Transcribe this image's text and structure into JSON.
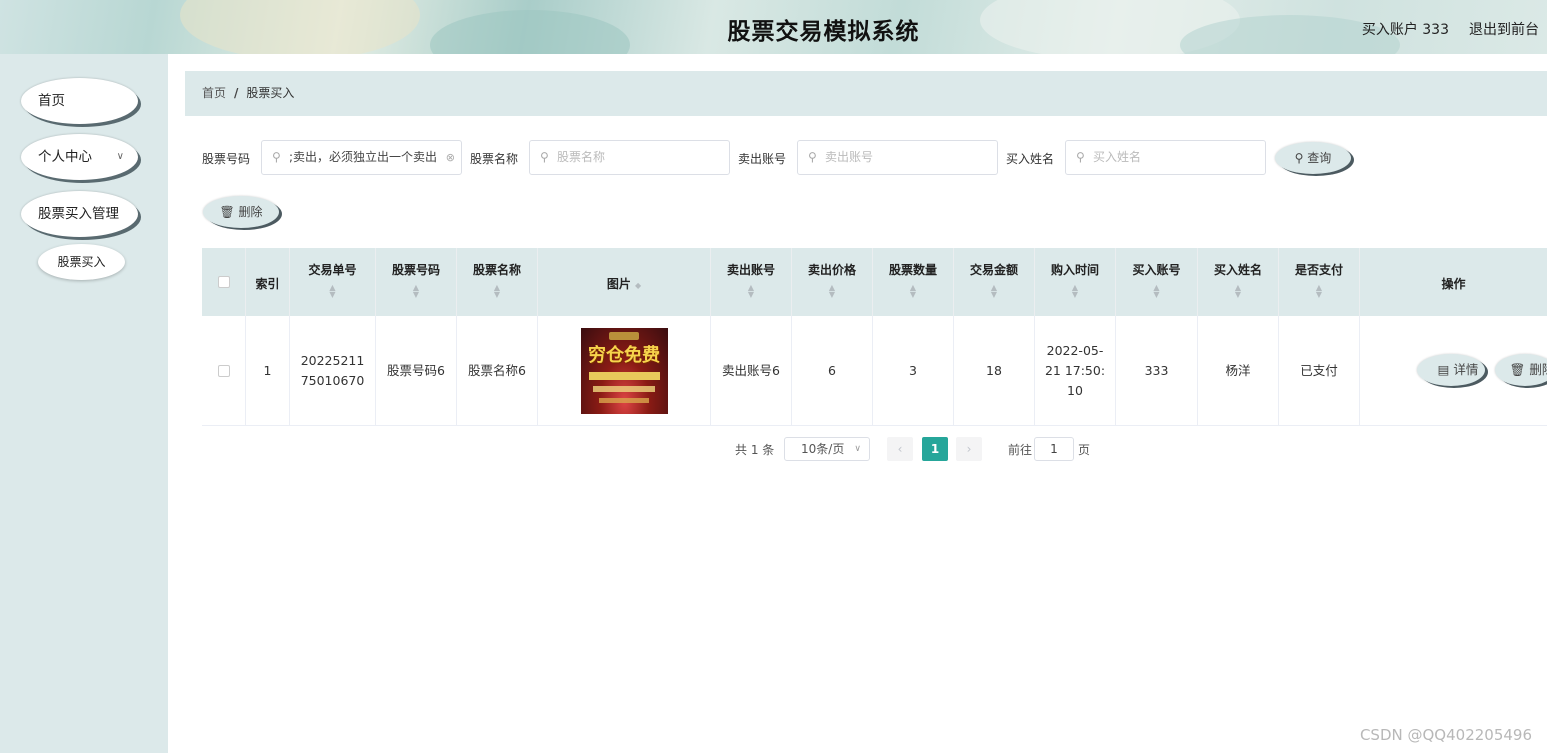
{
  "header": {
    "title": "股票交易模拟系统",
    "account_label": "买入账户 333",
    "logout_label": "退出到前台"
  },
  "sidebar": {
    "items": [
      {
        "label": "首页"
      },
      {
        "label": "个人中心",
        "icon": "chevron-down-icon"
      },
      {
        "label": "股票买入管理"
      }
    ],
    "sub_items": [
      {
        "label": "股票买入"
      }
    ]
  },
  "breadcrumb": {
    "home": "首页",
    "separator": "/",
    "current": "股票买入"
  },
  "search": {
    "fields": [
      {
        "label": "股票号码",
        "value": ";卖出，必须独立出一个卖出",
        "placeholder": "股票号码"
      },
      {
        "label": "股票名称",
        "value": "",
        "placeholder": "股票名称"
      },
      {
        "label": "卖出账号",
        "value": "",
        "placeholder": "卖出账号"
      },
      {
        "label": "买入姓名",
        "value": "",
        "placeholder": "买入姓名"
      }
    ],
    "query_label": "查询",
    "delete_label": "删除"
  },
  "table": {
    "columns": [
      "",
      "索引",
      "交易单号",
      "股票号码",
      "股票名称",
      "图片",
      "卖出账号",
      "卖出价格",
      "股票数量",
      "交易金额",
      "购入时间",
      "买入账号",
      "买入姓名",
      "是否支付",
      "操作"
    ],
    "rows": [
      {
        "index": "1",
        "order_no": "2022521175010670",
        "stock_code": "股票号码6",
        "stock_name": "股票名称6",
        "image_text": "穷仓免费",
        "seller_account": "卖出账号6",
        "sell_price": "6",
        "quantity": "3",
        "amount": "18",
        "purchase_time": "2022-05-21 17:50:10",
        "buyer_account": "333",
        "buyer_name": "杨洋",
        "paid": "已支付",
        "actions": {
          "detail": "详情",
          "delete": "删除"
        }
      }
    ]
  },
  "pagination": {
    "total": "共 1 条",
    "page_size": "10条/页",
    "current_page": "1",
    "goto_label": "前往",
    "goto_value": "1",
    "page_suffix": "页"
  },
  "watermark": "CSDN @QQ402205496",
  "colors": {
    "accent": "#26a69a",
    "panel": "#dce9ea",
    "button_shadow": "#4c5a60"
  }
}
